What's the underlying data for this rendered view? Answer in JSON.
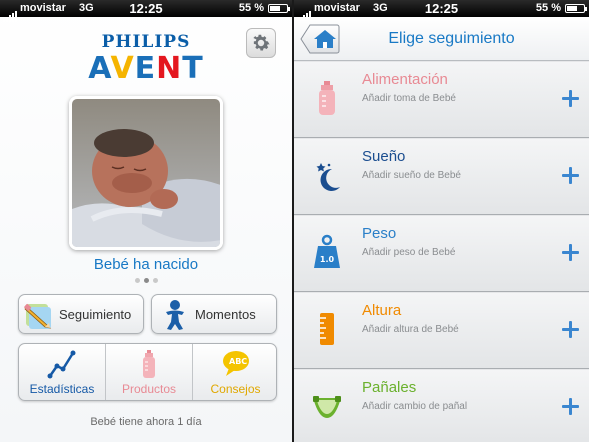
{
  "status_bar": {
    "carrier": "movistar",
    "network": "3G",
    "time": "12:25",
    "battery": "55 %",
    "battery_level": 0.55
  },
  "home": {
    "brand_top": "PHILIPS",
    "brand_bottom": "AVENT",
    "photo_caption": "Bebé ha nacido",
    "page_indicator": {
      "count": 3,
      "active": 1
    },
    "buttons": {
      "tracking": "Seguimiento",
      "moments": "Momentos"
    },
    "tabs": {
      "stats": "Estadísticas",
      "products": "Productos",
      "tips": "Consejos"
    },
    "baby_age": "Bebé tiene ahora 1 día",
    "colors": {
      "stats": "#1559a6",
      "products": "#e88a94",
      "tips": "#e0a800",
      "accent": "#1879c5"
    }
  },
  "tracking_screen": {
    "title": "Elige seguimiento",
    "items": [
      {
        "title": "Alimentación",
        "subtitle": "Añadir toma de Bebé",
        "icon": "bottle-icon",
        "color": "#e88a94"
      },
      {
        "title": "Sueño",
        "subtitle": "Añadir sueño de Bebé",
        "icon": "moon-stars-icon",
        "color": "#1a4d8f"
      },
      {
        "title": "Peso",
        "subtitle": "Añadir peso de Bebé",
        "icon": "weight-icon",
        "color": "#2a7fc8"
      },
      {
        "title": "Altura",
        "subtitle": "Añadir altura de Bebé",
        "icon": "ruler-icon",
        "color": "#f08a00"
      },
      {
        "title": "Pañales",
        "subtitle": "Añadir cambio de pañal",
        "icon": "diaper-icon",
        "color": "#6bb12e"
      }
    ],
    "weight_icon_text": "1.0"
  }
}
